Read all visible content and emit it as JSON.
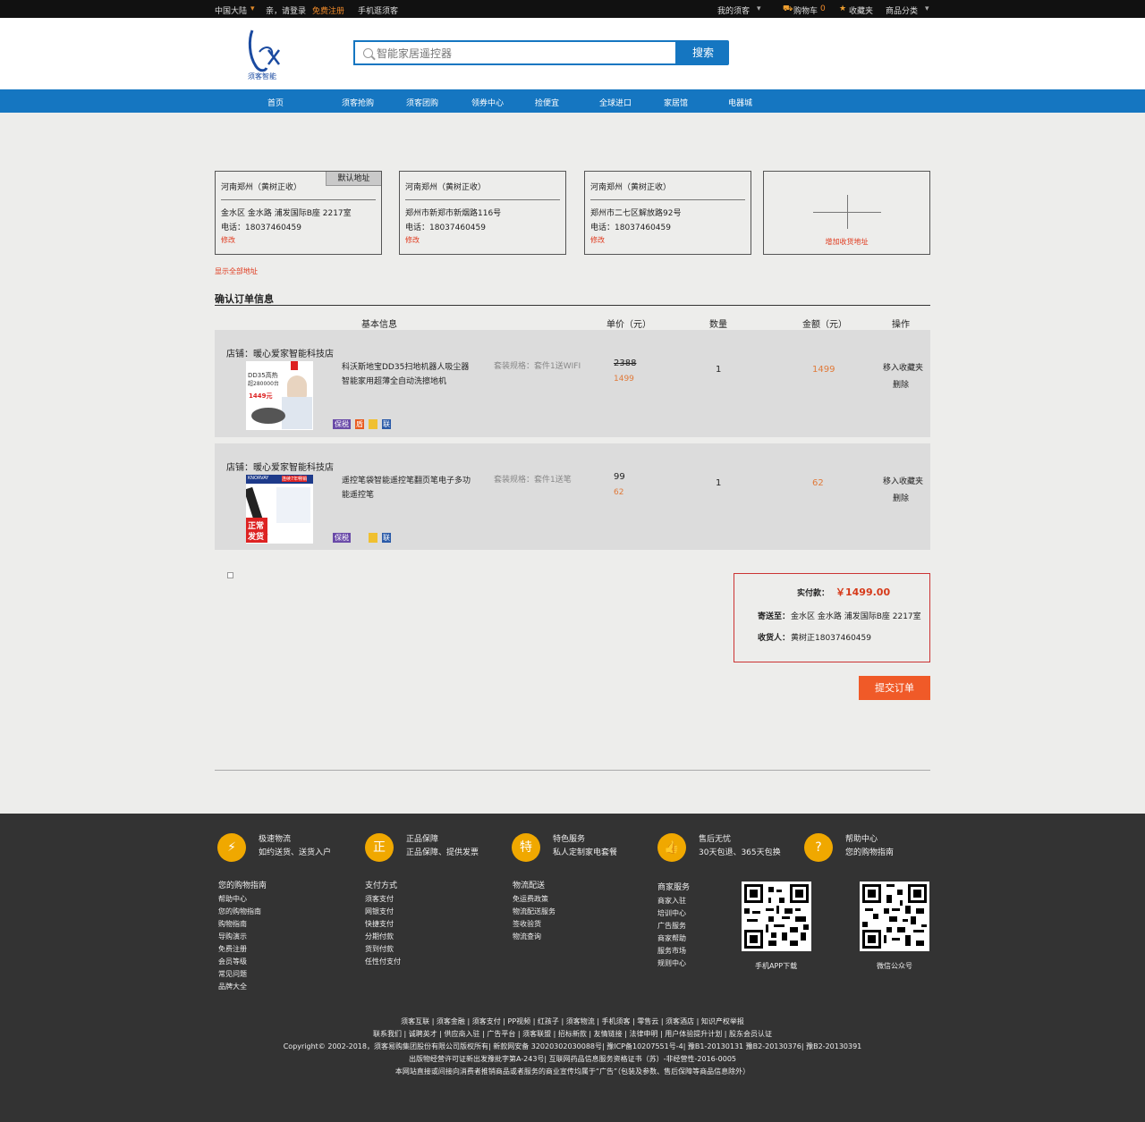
{
  "topbar": {
    "region": "中国大陆",
    "greeting": "亲，请登录",
    "register": "免费注册",
    "mobile": "手机逛须客",
    "my": "我的须客",
    "cart": "购物车",
    "cart_count": "0",
    "favorites": "收藏夹",
    "categories": "商品分类"
  },
  "logo": {
    "text": "须客智能"
  },
  "search": {
    "placeholder": "智能家居遥控器",
    "button": "搜索"
  },
  "nav": [
    "首页",
    "须客抢购",
    "须客团购",
    "领券中心",
    "捡便宜",
    "全球进口",
    "家居馆",
    "电器城"
  ],
  "addresses": [
    {
      "title": "河南郑州（黄树正收）",
      "detail": "金水区 金水路 浦发国际B座 2217室",
      "phone": "电话：18037460459",
      "edit": "修改",
      "default_label": "默认地址"
    },
    {
      "title": "河南郑州（黄树正收）",
      "detail": "郑州市新郑市新烟路116号",
      "phone": "电话：18037460459",
      "edit": "修改"
    },
    {
      "title": "河南郑州（黄树正收）",
      "detail": "郑州市二七区解放路92号",
      "phone": "电话：18037460459",
      "edit": "修改"
    }
  ],
  "add_address": "增加收货地址",
  "show_all": "显示全部地址",
  "section_title": "确认订单信息",
  "table_headers": {
    "info": "基本信息",
    "price": "单价（元）",
    "qty": "数量",
    "amount": "金额（元）",
    "ops": "操作"
  },
  "items": [
    {
      "shop": "店铺：暖心爱家智能科技店",
      "name": "科沃斯地宝DD35扫地机器人吸尘器智能家用超薄全自动洗擦地机",
      "spec": "套装规格：套件1送WIFI",
      "orig_price": "2388",
      "price": "1499",
      "qty": "1",
      "amount": "1499",
      "fav": "移入收藏夹",
      "del": "删除",
      "img_text": [
        "DD35高热",
        "超280000台",
        "1449元"
      ],
      "badges": [
        "保税",
        "盾",
        "",
        "联"
      ]
    },
    {
      "shop": "店铺：暖心爱家智能科技店",
      "name": "遥控笔袋智能遥控笔翻页笔电子多功能遥控笔",
      "spec": "套装规格：套件1送笔",
      "orig_price": "99",
      "price": "62",
      "qty": "1",
      "amount": "62",
      "fav": "移入收藏夹",
      "del": "删除",
      "img_text": [
        "KNORVAY",
        "连续7年畅销",
        "正常",
        "发货"
      ],
      "badges": [
        "保税",
        "",
        "联"
      ]
    }
  ],
  "summary": {
    "paid_label": "实付款：",
    "paid_value": "￥1499.00",
    "ship_label": "寄送至：",
    "ship_value": "金水区 金水路 浦发国际B座 2217室",
    "recv_label": "收货人：",
    "recv_value": "黄树正18037460459"
  },
  "submit": "提交订单",
  "footer": {
    "features": [
      {
        "icon": "lightning-icon",
        "glyph": "⚡",
        "title": "极速物流",
        "sub": "如约送货、送货入户"
      },
      {
        "icon": "shield-icon",
        "glyph": "正",
        "title": "正品保障",
        "sub": "正品保障、提供发票"
      },
      {
        "icon": "special-icon",
        "glyph": "特",
        "title": "特色服务",
        "sub": "私人定制家电套餐"
      },
      {
        "icon": "thumbs-up-icon",
        "glyph": "👍",
        "title": "售后无忧",
        "sub": "30天包退、365天包换"
      },
      {
        "icon": "question-icon",
        "glyph": "?",
        "title": "帮助中心",
        "sub": "您的购物指南"
      }
    ],
    "columns": [
      {
        "title": "您的购物指南",
        "links": [
          "帮助中心",
          "您的购物指南",
          "购物指南",
          "导购演示",
          "免费注册",
          "会员等级",
          "常见问题",
          "品牌大全"
        ]
      },
      {
        "title": "支付方式",
        "links": [
          "须客支付",
          "网银支付",
          "快捷支付",
          "分期付款",
          "货到付款",
          "任性付支付"
        ]
      },
      {
        "title": "物流配送",
        "links": [
          "免运费政策",
          "物流配送服务",
          "签收验货",
          "物流查询"
        ]
      },
      {
        "title": "商家服务",
        "links": [
          "商家入驻",
          "培训中心",
          "广告服务",
          "商家帮助",
          "服务市场",
          "规则中心"
        ]
      }
    ],
    "qr": [
      {
        "label": "手机APP下载"
      },
      {
        "label": "微信公众号"
      }
    ],
    "bottom": [
      "须客互联 | 须客金融 | 须客支付 | PP视频 | 红孩子 | 须客物流 | 手机须客 | 零售云 | 须客酒店 | 知识产权举报",
      "联系我们 | 诚聘英才 | 供应商入驻 | 广告平台 | 须客联盟 | 招标新款 | 友情链接 | 法律申明 | 用户体验提升计划 | 股东会员认证",
      "Copyright© 2002-2018，须客易购集团股份有限公司版权所有| 新款网安备 32020302030088号| 豫ICP备10207551号-4| 豫B1-20130131 豫B2-20130376| 豫B2-20130391",
      "出版物经营许可证新出发豫批字第A-243号| 互联网药品信息服务资格证书（苏）-非经营性-2016-0005",
      "本网站直接或间接向消费者推销商品或者服务的商业宣传均属于“广告”（包装及参数、售后保障等商品信息除外）"
    ]
  }
}
